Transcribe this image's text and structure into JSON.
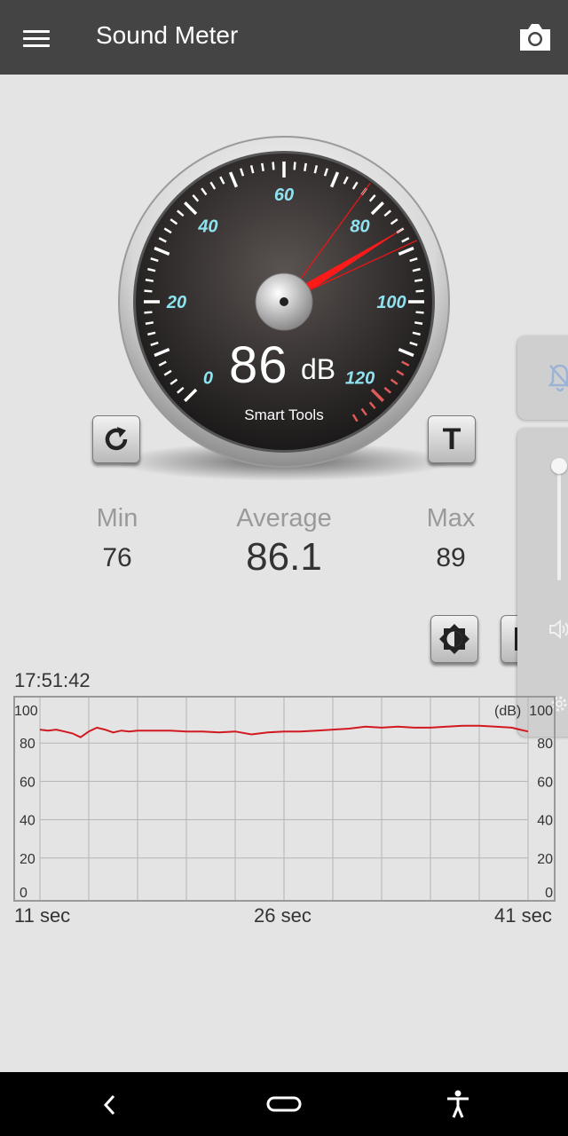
{
  "app": {
    "title": "Sound Meter"
  },
  "icons": {
    "menu": "hamburger-menu-icon",
    "camera": "camera-icon",
    "reset": "refresh-icon",
    "text": "text-T-icon",
    "brightness": "brightness-icon",
    "pause": "pause-icon",
    "bell_off": "bell-off-icon",
    "volume": "volume-icon",
    "back": "back-chevron-icon",
    "home": "home-pill-icon",
    "accessibility": "accessibility-icon"
  },
  "gauge": {
    "value": "86",
    "unit": "dB",
    "brand": "Smart Tools",
    "reading": 86,
    "min_scale": 0,
    "max_scale": 120,
    "tick_labels": [
      "0",
      "20",
      "40",
      "60",
      "80",
      "100",
      "120"
    ]
  },
  "buttons": {
    "text_label": "T"
  },
  "stats": {
    "min_label": "Min",
    "min_value": "76",
    "avg_label": "Average",
    "avg_value": "86.1",
    "max_label": "Max",
    "max_value": "89"
  },
  "chart": {
    "timestamp": "17:51:42",
    "unit_label": "(dB)",
    "y_labels": [
      "100",
      "80",
      "60",
      "40",
      "20",
      "0"
    ],
    "x_labels": [
      "11 sec",
      "26 sec",
      "41 sec"
    ],
    "colors": {
      "line": "#d2191f",
      "grid": "#b8b8b8",
      "frame": "#999999"
    }
  },
  "chart_data": {
    "type": "line",
    "xlabel": "",
    "ylabel": "",
    "xlim": [
      11,
      41
    ],
    "ylim": [
      0,
      100
    ],
    "grid": true,
    "x": [
      11,
      11.5,
      12,
      12.5,
      13,
      13.5,
      14,
      14.5,
      15,
      15.5,
      16,
      16.5,
      17,
      18,
      19,
      20,
      21,
      22,
      23,
      24,
      24.5,
      25,
      26,
      27,
      28,
      29,
      30,
      31,
      32,
      33,
      34,
      35,
      36,
      37,
      38,
      39,
      40,
      40.5,
      41
    ],
    "series": [
      {
        "values": [
          87,
          86.5,
          87,
          86,
          85,
          83,
          86,
          88,
          87,
          85.5,
          86.5,
          86,
          86.5,
          86.5,
          86.5,
          86,
          86,
          85.5,
          86,
          84.5,
          85,
          85.5,
          86,
          86,
          86.5,
          87,
          87.5,
          88.5,
          88,
          88.5,
          88,
          88,
          88.5,
          89,
          89,
          88.5,
          88,
          87,
          86
        ]
      }
    ]
  }
}
